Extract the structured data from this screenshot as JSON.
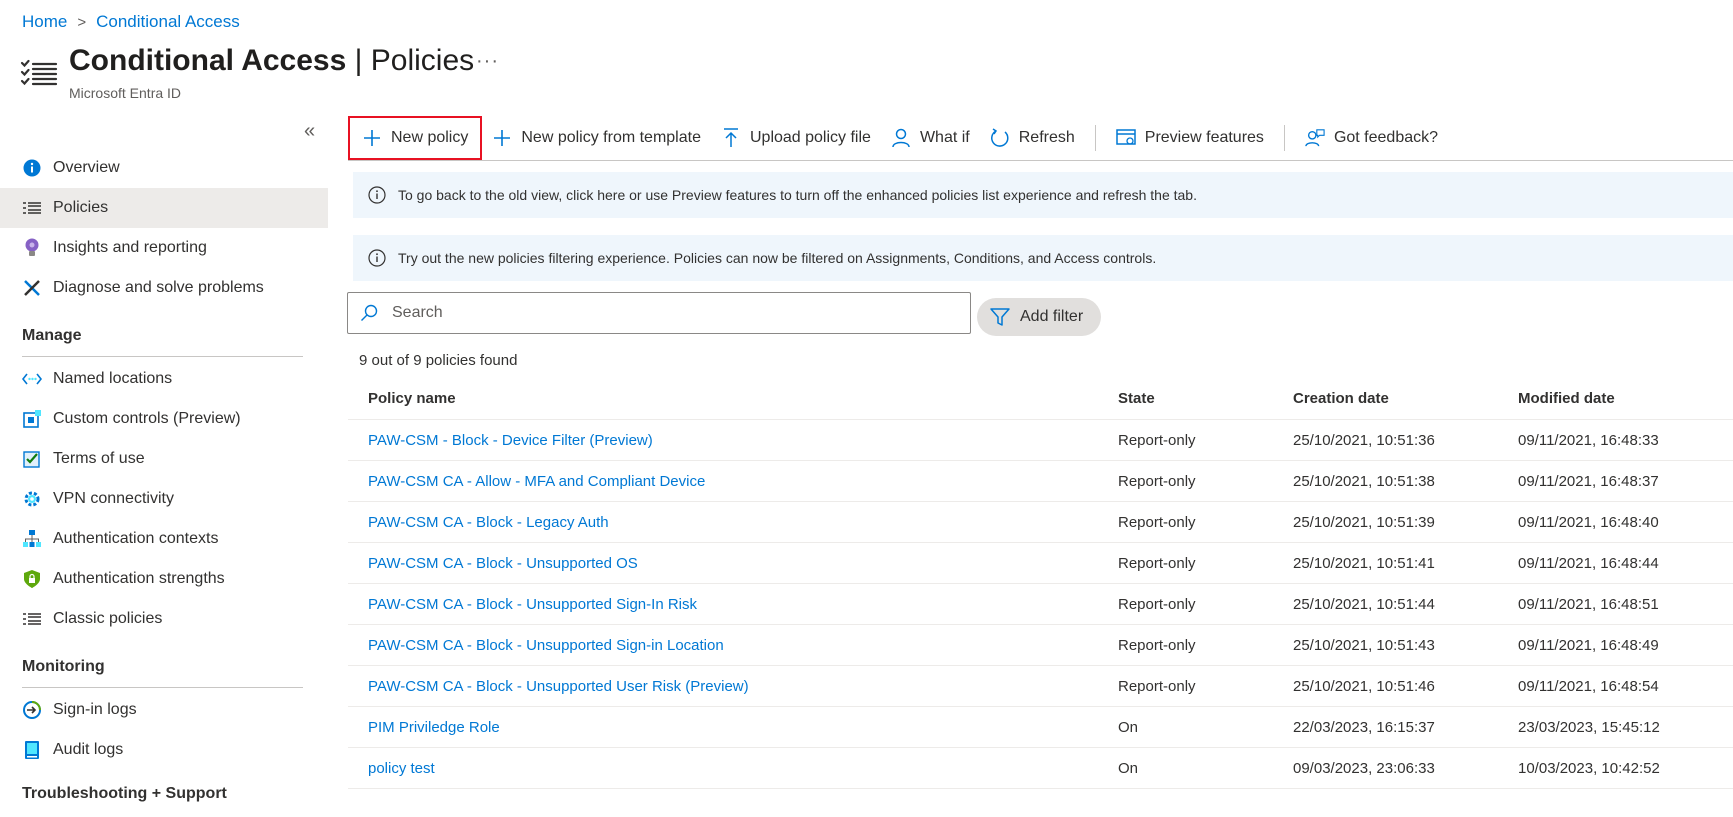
{
  "breadcrumb": {
    "home": "Home",
    "current": "Conditional Access"
  },
  "header": {
    "title_bold": "Conditional Access",
    "title_sep": "|",
    "title_rest": "Policies",
    "more": "···",
    "subtitle": "Microsoft Entra ID"
  },
  "sidebar": {
    "collapse": "«",
    "items": [
      {
        "label": "Overview",
        "icon": "info-icon",
        "selected": false
      },
      {
        "label": "Policies",
        "icon": "list-icon",
        "selected": true
      },
      {
        "label": "Insights and reporting",
        "icon": "lightbulb-icon",
        "selected": false
      },
      {
        "label": "Diagnose and solve problems",
        "icon": "wrench-icon",
        "selected": false
      }
    ],
    "manage_header": "Manage",
    "manage_items": [
      {
        "label": "Named locations",
        "icon": "location-icon"
      },
      {
        "label": "Custom controls (Preview)",
        "icon": "custom-controls-icon"
      },
      {
        "label": "Terms of use",
        "icon": "checkbox-icon"
      },
      {
        "label": "VPN connectivity",
        "icon": "gear-icon"
      },
      {
        "label": "Authentication contexts",
        "icon": "hierarchy-icon"
      },
      {
        "label": "Authentication strengths",
        "icon": "shield-icon"
      },
      {
        "label": "Classic policies",
        "icon": "list-icon"
      }
    ],
    "monitoring_header": "Monitoring",
    "monitoring_items": [
      {
        "label": "Sign-in logs",
        "icon": "signin-icon"
      },
      {
        "label": "Audit logs",
        "icon": "book-icon"
      }
    ],
    "troubleshooting_header": "Troubleshooting + Support"
  },
  "toolbar": {
    "new_policy": "New policy",
    "new_from_template": "New policy from template",
    "upload": "Upload policy file",
    "what_if": "What if",
    "refresh": "Refresh",
    "preview": "Preview features",
    "feedback": "Got feedback?"
  },
  "banners": {
    "old_view": "To go back to the old view, click here or use Preview features to turn off the enhanced policies list experience and refresh the tab.",
    "filtering": "Try out the new policies filtering experience. Policies can now be filtered on Assignments, Conditions, and Access controls."
  },
  "search": {
    "placeholder": "Search",
    "value": ""
  },
  "filter": {
    "label": "Add filter"
  },
  "result_count": "9 out of 9 policies found",
  "table": {
    "headers": {
      "name": "Policy name",
      "state": "State",
      "created": "Creation date",
      "modified": "Modified date"
    },
    "rows": [
      {
        "name": "PAW-CSM - Block - Device Filter (Preview)",
        "state": "Report-only",
        "created": "25/10/2021, 10:51:36",
        "modified": "09/11/2021, 16:48:33"
      },
      {
        "name": "PAW-CSM CA - Allow - MFA and Compliant Device",
        "state": "Report-only",
        "created": "25/10/2021, 10:51:38",
        "modified": "09/11/2021, 16:48:37"
      },
      {
        "name": "PAW-CSM CA - Block - Legacy Auth",
        "state": "Report-only",
        "created": "25/10/2021, 10:51:39",
        "modified": "09/11/2021, 16:48:40"
      },
      {
        "name": "PAW-CSM CA - Block - Unsupported OS",
        "state": "Report-only",
        "created": "25/10/2021, 10:51:41",
        "modified": "09/11/2021, 16:48:44"
      },
      {
        "name": "PAW-CSM CA - Block - Unsupported Sign-In Risk",
        "state": "Report-only",
        "created": "25/10/2021, 10:51:44",
        "modified": "09/11/2021, 16:48:51"
      },
      {
        "name": "PAW-CSM CA - Block - Unsupported Sign-in Location",
        "state": "Report-only",
        "created": "25/10/2021, 10:51:43",
        "modified": "09/11/2021, 16:48:49"
      },
      {
        "name": "PAW-CSM CA - Block - Unsupported User Risk (Preview)",
        "state": "Report-only",
        "created": "25/10/2021, 10:51:46",
        "modified": "09/11/2021, 16:48:54"
      },
      {
        "name": "PIM Priviledge Role",
        "state": "On",
        "created": "22/03/2023, 16:15:37",
        "modified": "23/03/2023, 15:45:12"
      },
      {
        "name": "policy test",
        "state": "On",
        "created": "09/03/2023, 23:06:33",
        "modified": "10/03/2023, 10:42:52"
      }
    ]
  },
  "colors": {
    "accent": "#0078d4",
    "highlight_border": "#e81123",
    "banner_bg": "#eff6fc",
    "selected_bg": "#edebe9"
  }
}
